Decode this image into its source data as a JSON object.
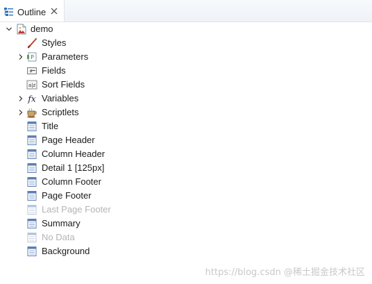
{
  "tab": {
    "label": "Outline",
    "icon": "outline-view-icon",
    "close_icon": "close-icon"
  },
  "tree": {
    "root": {
      "label": "demo",
      "icon": "report-icon",
      "expanded": true
    },
    "nodes": [
      {
        "label": "Styles",
        "icon": "brush-icon",
        "expandable": false,
        "enabled": true
      },
      {
        "label": "Parameters",
        "icon": "parameters-icon",
        "expandable": true,
        "enabled": true
      },
      {
        "label": "Fields",
        "icon": "fields-icon",
        "expandable": false,
        "enabled": true
      },
      {
        "label": "Sort Fields",
        "icon": "sort-fields-icon",
        "expandable": false,
        "enabled": true
      },
      {
        "label": "Variables",
        "icon": "fx-icon",
        "expandable": true,
        "enabled": true
      },
      {
        "label": "Scriptlets",
        "icon": "coffee-cup-icon",
        "expandable": true,
        "enabled": true
      },
      {
        "label": "Title",
        "icon": "band-icon",
        "expandable": false,
        "enabled": true
      },
      {
        "label": "Page Header",
        "icon": "band-icon",
        "expandable": false,
        "enabled": true
      },
      {
        "label": "Column Header",
        "icon": "band-icon",
        "expandable": false,
        "enabled": true
      },
      {
        "label": "Detail 1 [125px]",
        "icon": "band-icon",
        "expandable": false,
        "enabled": true
      },
      {
        "label": "Column Footer",
        "icon": "band-icon",
        "expandable": false,
        "enabled": true
      },
      {
        "label": "Page Footer",
        "icon": "band-icon",
        "expandable": false,
        "enabled": true
      },
      {
        "label": "Last Page Footer",
        "icon": "band-icon",
        "expandable": false,
        "enabled": false
      },
      {
        "label": "Summary",
        "icon": "band-icon",
        "expandable": false,
        "enabled": true
      },
      {
        "label": "No Data",
        "icon": "band-icon",
        "expandable": false,
        "enabled": false
      },
      {
        "label": "Background",
        "icon": "band-icon",
        "expandable": false,
        "enabled": true
      }
    ]
  },
  "watermark": "https://blog.csdn @稀土掘金技术社区",
  "colors": {
    "text": "#1a1a1a",
    "disabled_text": "#b4b4b4",
    "band_blue": "#5b7fb5",
    "tab_icon_blue": "#2f6fb8"
  }
}
